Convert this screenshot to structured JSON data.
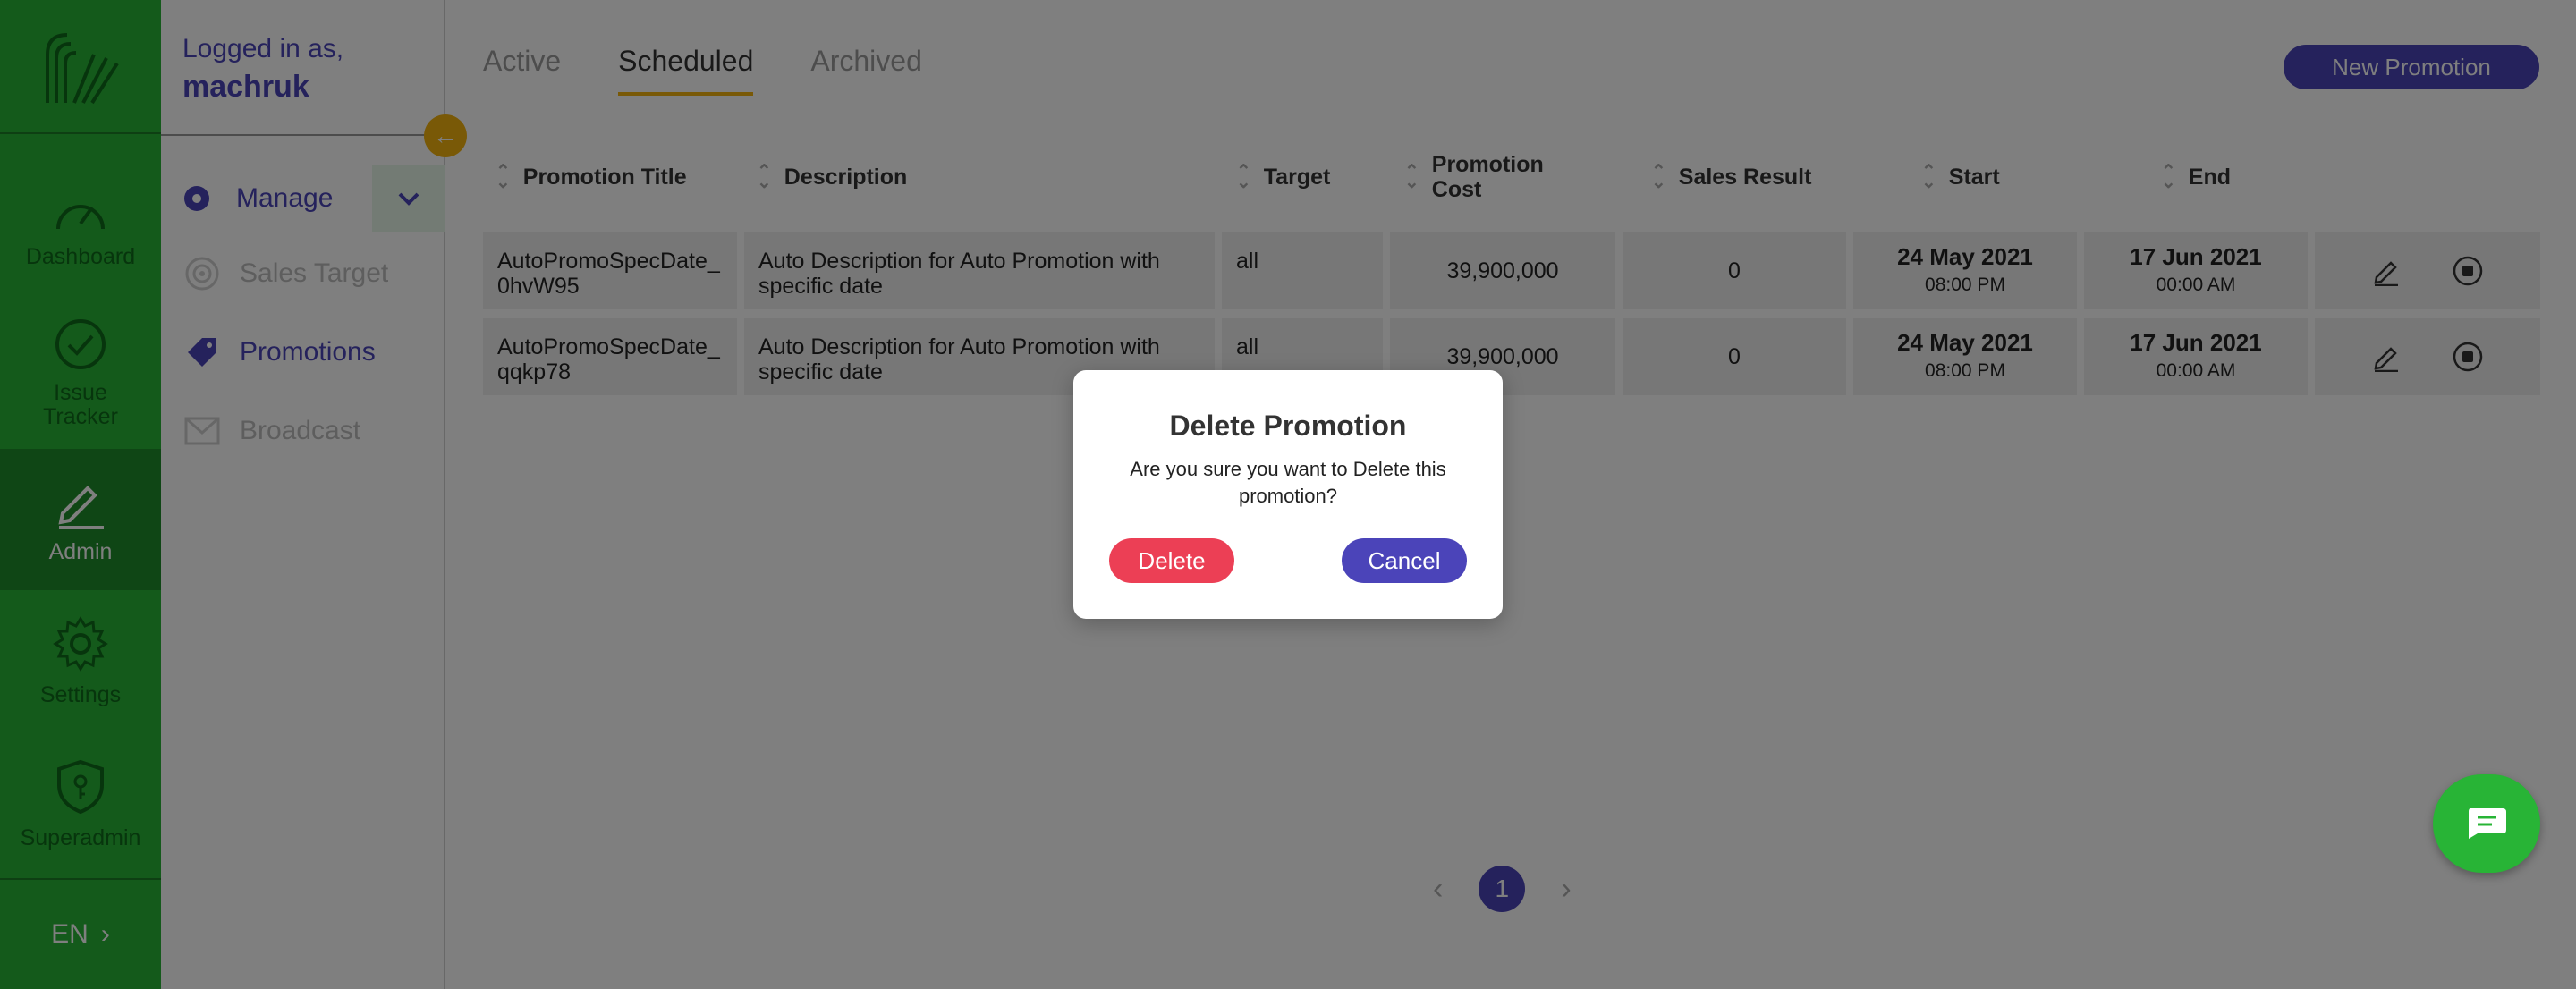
{
  "colors": {
    "brand_green": "#28b436",
    "accent_purple": "#4b44b9",
    "accent_yellow": "#f2b20f",
    "danger": "#ec3f55"
  },
  "rail": {
    "items": [
      {
        "label": "Dashboard",
        "icon": "speedometer-icon"
      },
      {
        "label": "Issue Tracker",
        "icon": "check-circle-icon"
      },
      {
        "label": "Admin",
        "icon": "pencil-icon"
      },
      {
        "label": "Settings",
        "icon": "gear-icon"
      },
      {
        "label": "Superadmin",
        "icon": "shield-key-icon"
      }
    ],
    "language": "EN"
  },
  "subnav": {
    "logged_in_label": "Logged in as,",
    "username": "machruk",
    "manage_label": "Manage",
    "items": [
      {
        "label": "Sales Target",
        "icon": "target-icon"
      },
      {
        "label": "Promotions",
        "icon": "tag-icon"
      },
      {
        "label": "Broadcast",
        "icon": "mail-icon"
      }
    ]
  },
  "tabs": [
    "Active",
    "Scheduled",
    "Archived"
  ],
  "active_tab": "Scheduled",
  "new_promotion_label": "New Promotion",
  "table": {
    "headers": [
      "Promotion Title",
      "Description",
      "Target",
      "Promotion Cost",
      "Sales Result",
      "Start",
      "End"
    ],
    "rows": [
      {
        "title": "AutoPromoSpecDate_0hvW95",
        "description": "Auto Description for Auto Promotion with specific date",
        "target": "all",
        "cost": "39,900,000",
        "sales": "0",
        "start_date": "24 May 2021",
        "start_time": "08:00 PM",
        "end_date": "17 Jun 2021",
        "end_time": "00:00 AM"
      },
      {
        "title": "AutoPromoSpecDate_qqkp78",
        "description": "Auto Description for Auto Promotion with specific date",
        "target": "all",
        "cost": "39,900,000",
        "sales": "0",
        "start_date": "24 May 2021",
        "start_time": "08:00 PM",
        "end_date": "17 Jun 2021",
        "end_time": "00:00 AM"
      }
    ]
  },
  "pagination": {
    "current": "1",
    "prev": "‹",
    "next": "›"
  },
  "modal": {
    "title": "Delete Promotion",
    "message": "Are you sure you want to Delete this promotion?",
    "delete_label": "Delete",
    "cancel_label": "Cancel"
  }
}
